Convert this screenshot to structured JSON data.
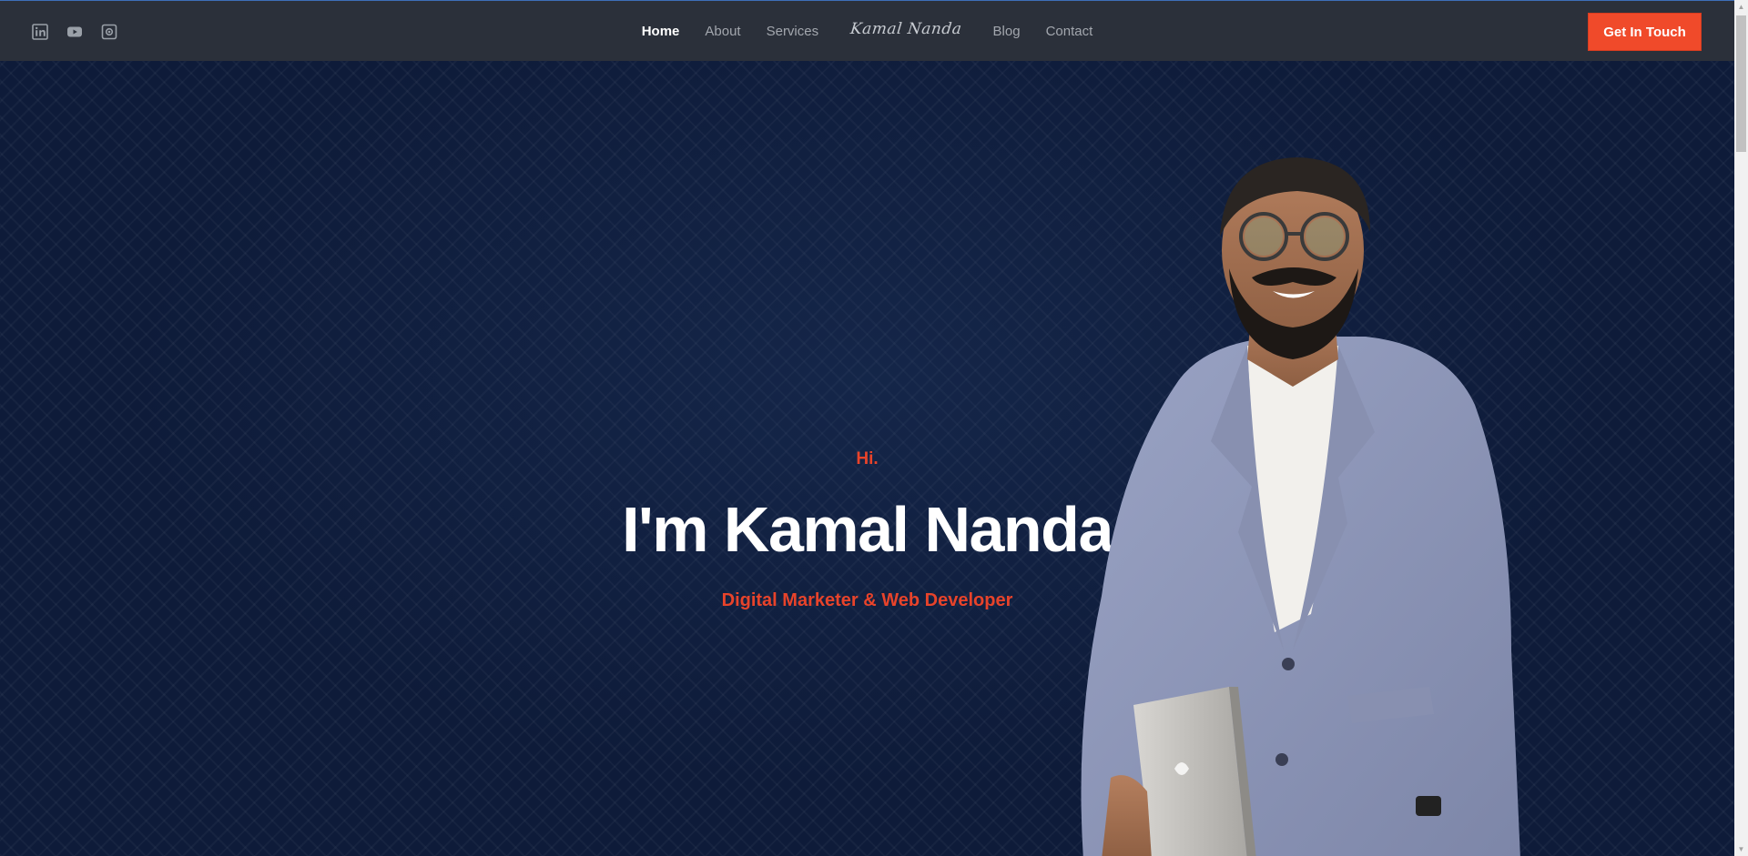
{
  "nav": {
    "social": [
      {
        "icon": "linkedin-icon"
      },
      {
        "icon": "youtube-icon"
      },
      {
        "icon": "instagram-icon"
      }
    ],
    "links_left": [
      "Home",
      "About",
      "Services"
    ],
    "logo_text": "Kamal Nanda",
    "links_right": [
      "Blog",
      "Contact"
    ],
    "active": "Home",
    "cta_label": "Get In Touch"
  },
  "hero": {
    "greeting": "Hi.",
    "headline": "I'm Kamal Nanda",
    "subtitle": "Digital Marketer & Web Developer"
  },
  "colors": {
    "navbar_bg": "#2b303a",
    "hero_bg": "#0e1b39",
    "accent": "#f04a2a",
    "text_white": "#ffffff",
    "nav_text": "#a3a7ae"
  }
}
